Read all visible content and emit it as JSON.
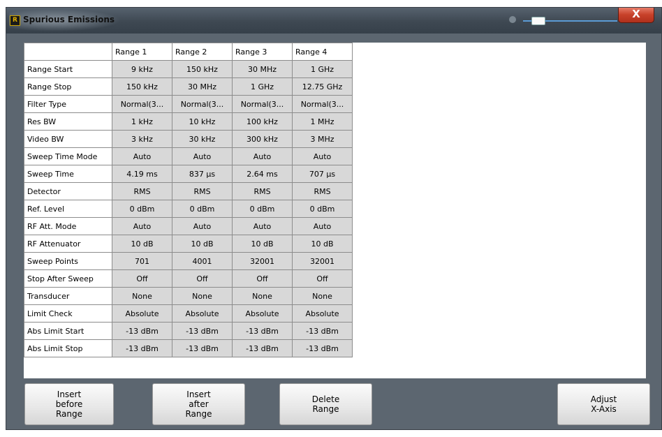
{
  "window": {
    "title": "Spurious Emissions",
    "close_label": "X"
  },
  "table": {
    "columns": [
      "Range 1",
      "Range 2",
      "Range 3",
      "Range 4"
    ],
    "rows": [
      {
        "label": "Range Start",
        "values": [
          "9 kHz",
          "150 kHz",
          "30 MHz",
          "1 GHz"
        ]
      },
      {
        "label": "Range Stop",
        "values": [
          "150 kHz",
          "30 MHz",
          "1 GHz",
          "12.75 GHz"
        ]
      },
      {
        "label": "Filter Type",
        "values": [
          "Normal(3...",
          "Normal(3...",
          "Normal(3...",
          "Normal(3..."
        ]
      },
      {
        "label": "Res BW",
        "values": [
          "1 kHz",
          "10 kHz",
          "100 kHz",
          "1 MHz"
        ]
      },
      {
        "label": "Video BW",
        "values": [
          "3 kHz",
          "30 kHz",
          "300 kHz",
          "3 MHz"
        ]
      },
      {
        "label": "Sweep Time Mode",
        "values": [
          "Auto",
          "Auto",
          "Auto",
          "Auto"
        ]
      },
      {
        "label": "Sweep Time",
        "values": [
          "4.19 ms",
          "837 µs",
          "2.64 ms",
          "707 µs"
        ]
      },
      {
        "label": "Detector",
        "values": [
          "RMS",
          "RMS",
          "RMS",
          "RMS"
        ]
      },
      {
        "label": "Ref. Level",
        "values": [
          "0 dBm",
          "0 dBm",
          "0 dBm",
          "0 dBm"
        ]
      },
      {
        "label": "RF Att. Mode",
        "values": [
          "Auto",
          "Auto",
          "Auto",
          "Auto"
        ]
      },
      {
        "label": "RF Attenuator",
        "values": [
          "10 dB",
          "10 dB",
          "10 dB",
          "10 dB"
        ]
      },
      {
        "label": "Sweep Points",
        "values": [
          "701",
          "4001",
          "32001",
          "32001"
        ]
      },
      {
        "label": "Stop After Sweep",
        "values": [
          "Off",
          "Off",
          "Off",
          "Off"
        ]
      },
      {
        "label": "Transducer",
        "values": [
          "None",
          "None",
          "None",
          "None"
        ]
      },
      {
        "label": "Limit Check",
        "values": [
          "Absolute",
          "Absolute",
          "Absolute",
          "Absolute"
        ]
      },
      {
        "label": "Abs Limit Start",
        "values": [
          "-13 dBm",
          "-13 dBm",
          "-13 dBm",
          "-13 dBm"
        ]
      },
      {
        "label": "Abs Limit Stop",
        "values": [
          "-13 dBm",
          "-13 dBm",
          "-13 dBm",
          "-13 dBm"
        ]
      }
    ]
  },
  "buttons": {
    "insert_before": "Insert\nbefore\nRange",
    "insert_after": "Insert\nafter\nRange",
    "delete": "Delete\nRange",
    "adjust_x": "Adjust\nX-Axis"
  },
  "colors": {
    "frame": "#5c6670",
    "cell_bg": "#d8d8d8",
    "close_button": "#c7412a"
  }
}
